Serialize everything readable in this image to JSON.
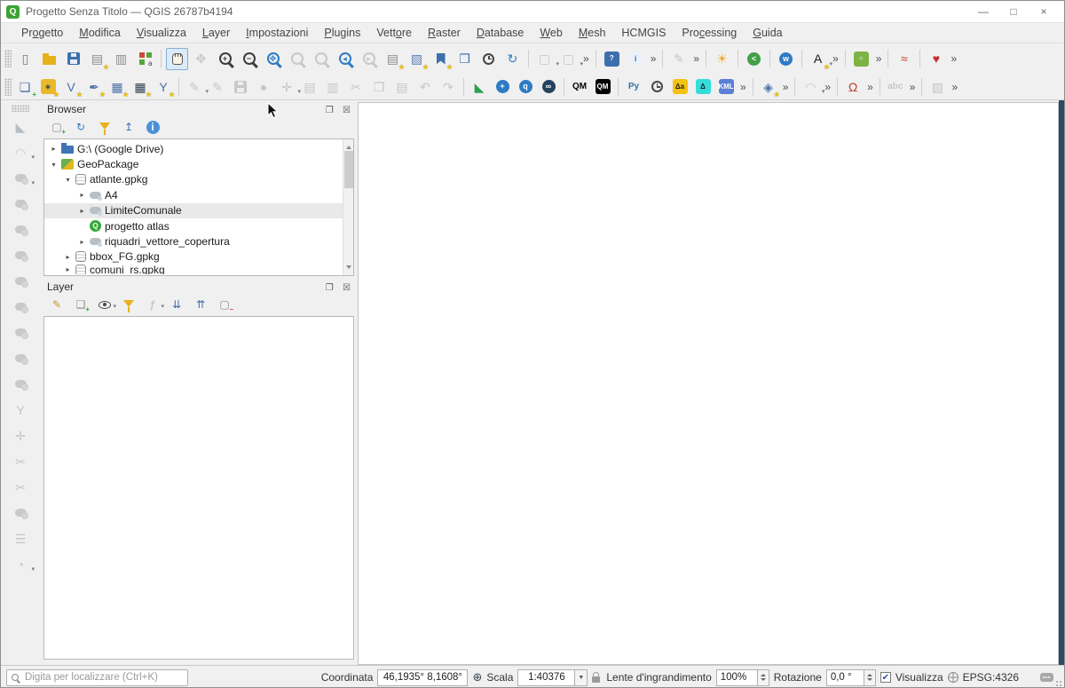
{
  "window": {
    "title": "Progetto Senza Titolo — QGIS 26787b4194",
    "app_icon": "Q",
    "controls": {
      "minimize": "—",
      "maximize": "□",
      "close": "×"
    }
  },
  "badges": {
    "star": "★",
    "plus": "+",
    "minus": "−"
  },
  "menubar": {
    "items": [
      {
        "label": "Progetto",
        "u": 2
      },
      {
        "label": "Modifica",
        "u": 0
      },
      {
        "label": "Visualizza",
        "u": 0
      },
      {
        "label": "Layer",
        "u": 0
      },
      {
        "label": "Impostazioni",
        "u": 0
      },
      {
        "label": "Plugins",
        "u": 0
      },
      {
        "label": "Vettore",
        "u": 4
      },
      {
        "label": "Raster",
        "u": 0
      },
      {
        "label": "Database",
        "u": 0
      },
      {
        "label": "Web",
        "u": 0
      },
      {
        "label": "Mesh",
        "u": 0
      },
      {
        "label": "HCMGIS",
        "u": -1
      },
      {
        "label": "Processing",
        "u": 3
      },
      {
        "label": "Guida",
        "u": 0
      }
    ]
  },
  "toolbars": {
    "row1": [
      {
        "t": "grip"
      },
      {
        "n": "new-project",
        "g": "▯",
        "fg": "#777777"
      },
      {
        "n": "open-project",
        "cls": "ic-folder"
      },
      {
        "n": "save-project",
        "cls": "ic-floppy"
      },
      {
        "n": "new-print-layout",
        "g": "▤",
        "fg": "#8a8a8a",
        "b": "star"
      },
      {
        "n": "layout-manager",
        "g": "▥",
        "fg": "#8a8a8a"
      },
      {
        "n": "style-manager",
        "cls": "ic-style"
      },
      {
        "t": "sep"
      },
      {
        "n": "pan-map",
        "cls": "ic-hand",
        "a": 1
      },
      {
        "n": "pan-to-selection",
        "g": "✥",
        "fg": "#c6c6c6",
        "e": 0
      },
      {
        "n": "zoom-in",
        "cls": "ic-mag",
        "g": "+"
      },
      {
        "n": "zoom-out",
        "cls": "ic-mag",
        "g": "−"
      },
      {
        "n": "zoom-full-extent",
        "cls": "ic-mag",
        "g": "✥",
        "fg": "#2e7bc4"
      },
      {
        "n": "zoom-to-selection",
        "cls": "ic-mag",
        "fg": "#c8c8c8",
        "e": 0
      },
      {
        "n": "zoom-to-layer",
        "cls": "ic-mag",
        "fg": "#c8c8c8",
        "e": 0
      },
      {
        "n": "zoom-last",
        "cls": "ic-mag",
        "g": "◂",
        "fg": "#2e7bc4"
      },
      {
        "n": "zoom-next",
        "cls": "ic-mag",
        "g": "▸",
        "fg": "#c8c8c8",
        "e": 0
      },
      {
        "n": "new-map-view",
        "g": "▤",
        "fg": "#8a8a8a",
        "b": "star"
      },
      {
        "n": "new-3d-map-view",
        "g": "▧",
        "fg": "#5a7fb5",
        "b": "star"
      },
      {
        "n": "new-spatial-bookmark",
        "cls": "ic-bookmark",
        "b": "star"
      },
      {
        "n": "show-spatial-bookmarks",
        "g": "❐",
        "fg": "#3d6fae"
      },
      {
        "n": "temporal-controller",
        "cls": "ic-clock"
      },
      {
        "n": "refresh-map",
        "g": "↻",
        "fg": "#2e7bc4"
      },
      {
        "t": "sep"
      },
      {
        "n": "select-features",
        "g": "▢",
        "fg": "#c6c6c6",
        "e": 0,
        "d": 1
      },
      {
        "n": "deselect-features",
        "g": "▢",
        "fg": "#c6c6c6",
        "e": 0,
        "d": 1
      },
      {
        "t": "more",
        "n": "selection-overflow"
      },
      {
        "t": "sep"
      },
      {
        "n": "help-contents",
        "cls": "sq",
        "g": "?",
        "bg": "#3d6fae",
        "fg": "#ffffff"
      },
      {
        "n": "identify-features",
        "cls": "ic-circle",
        "g": "i",
        "bg": "#eaf1fa",
        "fg": "#2e7bc4"
      },
      {
        "t": "more",
        "n": "attributes-overflow"
      },
      {
        "t": "sep"
      },
      {
        "n": "pin-labels",
        "g": "✎",
        "fg": "#c6c6c6",
        "e": 0
      },
      {
        "t": "more",
        "n": "labels-overflow"
      },
      {
        "t": "sep"
      },
      {
        "n": "sun-calc-plugin",
        "g": "☀",
        "fg": "#f5a623"
      },
      {
        "t": "sep"
      },
      {
        "n": "share-plugin",
        "cls": "ic-circle",
        "g": "<",
        "bg": "#43a047",
        "fg": "#ffffff"
      },
      {
        "t": "sep"
      },
      {
        "n": "web-service-plugin",
        "cls": "ic-circle",
        "g": "w",
        "bg": "#2e7bc4",
        "fg": "#ffffff"
      },
      {
        "t": "sep"
      },
      {
        "n": "layer-labeling-options",
        "g": "A",
        "fg": "#1a1a1a",
        "b": "star",
        "d": 1
      },
      {
        "t": "more",
        "n": "labeling-overflow"
      },
      {
        "t": "sep"
      },
      {
        "n": "quickosm",
        "cls": "sq",
        "g": "○",
        "bg": "#7cb342",
        "fg": "#ffffff"
      },
      {
        "t": "more",
        "n": "quickosm-overflow"
      },
      {
        "t": "sep"
      },
      {
        "n": "data-plotly",
        "g": "≈",
        "fg": "#c0392b"
      },
      {
        "t": "sep"
      },
      {
        "n": "document-generator-plugin",
        "g": "♥",
        "fg": "#cc2f2f"
      },
      {
        "t": "more",
        "n": "plugins-overflow"
      }
    ],
    "row2": [
      {
        "t": "grip"
      },
      {
        "n": "data-source-manager",
        "g": "❏",
        "fg": "#4a6fa5",
        "b": "plus"
      },
      {
        "n": "new-geopackage-layer",
        "cls": "sq",
        "g": "◈",
        "bg": "#e8b92a",
        "fg": "#2c3e50",
        "b": "star"
      },
      {
        "n": "new-shapefile-layer",
        "g": "V",
        "fg": "#4a6fa5",
        "b": "star"
      },
      {
        "n": "new-spatialite-layer",
        "g": "✒",
        "fg": "#4a6fa5",
        "b": "star"
      },
      {
        "n": "new-temporary-scratch-layer",
        "g": "▦",
        "fg": "#4a6fa5",
        "b": "star"
      },
      {
        "n": "new-virtual-layer",
        "g": "▦",
        "fg": "#2c3e50",
        "b": "star"
      },
      {
        "n": "new-mesh-layer",
        "g": "Y",
        "fg": "#4a6fa5",
        "b": "star"
      },
      {
        "t": "sep"
      },
      {
        "n": "current-edits",
        "g": "✎",
        "fg": "#c6c6c6",
        "e": 0,
        "d": 1
      },
      {
        "n": "toggle-editing",
        "g": "✎",
        "fg": "#c6c6c6",
        "e": 0
      },
      {
        "n": "save-layer-edits",
        "cls": "ic-floppy dis",
        "e": 0
      },
      {
        "n": "add-feature",
        "g": "●",
        "fg": "#c6c6c6",
        "e": 0
      },
      {
        "n": "move-feature",
        "g": "✛",
        "fg": "#c6c6c6",
        "e": 0,
        "d": 1
      },
      {
        "n": "multiedit-attributes",
        "g": "▤",
        "fg": "#c6c6c6",
        "e": 0
      },
      {
        "n": "delete-selected",
        "g": "▥",
        "fg": "#c6c6c6",
        "e": 0
      },
      {
        "n": "cut-features",
        "g": "✂",
        "fg": "#c6c6c6",
        "e": 0
      },
      {
        "n": "copy-features",
        "g": "❐",
        "fg": "#c6c6c6",
        "e": 0
      },
      {
        "n": "paste-features",
        "g": "▤",
        "fg": "#c6c6c6",
        "e": 0
      },
      {
        "n": "undo",
        "g": "↶",
        "fg": "#c6c6c6",
        "e": 0
      },
      {
        "n": "redo",
        "g": "↷",
        "fg": "#c6c6c6",
        "e": 0
      },
      {
        "t": "sep"
      },
      {
        "n": "measure-tool",
        "g": "◣",
        "fg": "#2e9e4f"
      },
      {
        "n": "globe-add-layer",
        "cls": "ic-circle",
        "g": "+",
        "bg": "#2e7bc4",
        "fg": "#ffffff"
      },
      {
        "n": "globe-query-layer",
        "cls": "ic-circle",
        "g": "q",
        "bg": "#2e7bc4",
        "fg": "#ffffff"
      },
      {
        "n": "globe-search",
        "cls": "ic-circle",
        "g": "∞",
        "bg": "#24435f",
        "fg": "#ffffff"
      },
      {
        "t": "sep"
      },
      {
        "n": "qm-plugin",
        "cls": "txt",
        "g": "QM",
        "fg": "#000000"
      },
      {
        "n": "qm-console-plugin",
        "cls": "sq",
        "g": "QM",
        "bg": "#000000",
        "fg": "#ffffff"
      },
      {
        "t": "sep"
      },
      {
        "n": "python-console",
        "cls": "txt",
        "g": "Py",
        "fg": "#3771a2"
      },
      {
        "n": "timer-plugin",
        "cls": "ic-clock"
      },
      {
        "n": "delta-attributes-plugin",
        "cls": "sq",
        "g": "Δa",
        "bg": "#f5c211",
        "fg": "#222222"
      },
      {
        "n": "coordinate-converter-plugin",
        "cls": "sq",
        "g": "Δ",
        "bg": "#35dcdc",
        "fg": "#222222"
      },
      {
        "n": "kml-tools-plugin",
        "cls": "sq",
        "g": "KML",
        "bg": "#5b7fd4",
        "fg": "#ffffff"
      },
      {
        "t": "more",
        "n": "plugins2-overflow"
      },
      {
        "t": "sep"
      },
      {
        "n": "vertex-tool",
        "g": "◈",
        "fg": "#4a6fa5",
        "b": "star"
      },
      {
        "t": "more",
        "n": "digitizing-overflow"
      },
      {
        "t": "sep"
      },
      {
        "n": "circular-string-digitizing",
        "g": "◠",
        "fg": "#c6c6c6",
        "e": 0,
        "d": 1
      },
      {
        "t": "more",
        "n": "shape-digitizing-overflow"
      },
      {
        "t": "sep"
      },
      {
        "n": "snapping-toggle",
        "g": "Ω",
        "fg": "#c0392b"
      },
      {
        "t": "more",
        "n": "snapping-overflow"
      },
      {
        "t": "sep"
      },
      {
        "n": "abc-annotation",
        "cls": "txt",
        "g": "abc",
        "fg": "#c6c6c6",
        "e": 0
      },
      {
        "t": "more",
        "n": "annotation-overflow"
      },
      {
        "t": "sep"
      },
      {
        "n": "mesh-digitizing",
        "g": "▨",
        "fg": "#c6c6c6",
        "e": 0
      },
      {
        "t": "more",
        "n": "mesh-overflow"
      }
    ],
    "left": [
      {
        "t": "griph"
      },
      {
        "n": "advanced-digitizing-panel",
        "g": "◣",
        "fg": "#b8bec6",
        "e": 0
      },
      {
        "n": "circular-curve-tool",
        "g": "◠",
        "fg": "#c6c6c6",
        "e": 0,
        "d": 1
      },
      {
        "n": "move-feature-tool",
        "cls": "ic-blob",
        "e": 0,
        "d": 1
      },
      {
        "n": "rotate-feature-tool",
        "cls": "ic-blob",
        "e": 0
      },
      {
        "n": "simplify-feature-tool",
        "cls": "ic-blob",
        "e": 0
      },
      {
        "n": "add-ring-tool",
        "cls": "ic-blob",
        "e": 0
      },
      {
        "n": "add-part-tool",
        "cls": "ic-blob",
        "e": 0
      },
      {
        "n": "fill-ring-tool",
        "cls": "ic-blob",
        "e": 0
      },
      {
        "n": "delete-ring-tool",
        "cls": "ic-blob",
        "e": 0
      },
      {
        "n": "delete-part-tool",
        "cls": "ic-blob",
        "e": 0
      },
      {
        "n": "reshape-features-tool",
        "cls": "ic-blob",
        "e": 0
      },
      {
        "n": "offset-curve-tool",
        "g": "Y",
        "fg": "#c6c6c6",
        "e": 0
      },
      {
        "n": "split-features-tool",
        "g": "✛",
        "fg": "#c6c6c6",
        "e": 0
      },
      {
        "n": "split-parts-tool",
        "g": "✂",
        "fg": "#c6c6c6",
        "e": 0
      },
      {
        "n": "merge-features-tool",
        "g": "✂",
        "fg": "#c6c6c6",
        "e": 0
      },
      {
        "n": "rotate-point-symbols-tool",
        "cls": "ic-blob",
        "e": 0
      },
      {
        "n": "trim-extend-tool",
        "g": "☰",
        "fg": "#c6c6c6",
        "e": 0
      },
      {
        "n": "rotate-label-tool",
        "g": "◔",
        "fg": "#c6c6c6",
        "e": 0,
        "d": 1
      }
    ]
  },
  "browser_panel": {
    "title": "Browser",
    "float_button": "❐",
    "close_button": "☒",
    "tools": [
      {
        "n": "add-selected-layers",
        "g": "▢",
        "fg": "#8a8a8a",
        "b": "plus"
      },
      {
        "n": "refresh-browser",
        "g": "↻",
        "fg": "#2e7bc4"
      },
      {
        "n": "filter-browser",
        "cls": "ic-funnel"
      },
      {
        "n": "collapse-all-browser",
        "g": "↥",
        "fg": "#3d6fae"
      },
      {
        "n": "enable-properties-widget",
        "cls": "ic-circle",
        "g": "i",
        "bg": "#4a90d9",
        "fg": "#ffffff"
      }
    ],
    "tree": [
      {
        "lvl": 0,
        "exp": "▸",
        "ic": "folder-blue",
        "label": "G:\\ (Google Drive)"
      },
      {
        "lvl": 0,
        "exp": "▾",
        "ic": "gpkg-box",
        "label": "GeoPackage"
      },
      {
        "lvl": 1,
        "exp": "▾",
        "ic": "db",
        "label": "atlante.gpkg"
      },
      {
        "lvl": 2,
        "exp": "▸",
        "ic": "vlayer",
        "label": "A4"
      },
      {
        "lvl": 2,
        "exp": "▸",
        "ic": "vlayer",
        "label": "LimiteComunale",
        "sel": true
      },
      {
        "lvl": 2,
        "exp": "",
        "ic": "qgis",
        "icg": "Q",
        "label": "progetto atlas"
      },
      {
        "lvl": 2,
        "exp": "▸",
        "ic": "vlayer",
        "label": "riquadri_vettore_copertura"
      },
      {
        "lvl": 1,
        "exp": "▸",
        "ic": "db",
        "label": "bbox_FG.gpkg"
      },
      {
        "lvl": 1,
        "exp": "▸",
        "ic": "db",
        "label": "comuni_rs.gpkg",
        "cut": true
      }
    ]
  },
  "layer_panel": {
    "title": "Layer",
    "float_button": "❐",
    "close_button": "☒",
    "tools": [
      {
        "n": "open-layer-styling",
        "g": "✎",
        "fg": "#c79a2a"
      },
      {
        "n": "add-group",
        "g": "❏",
        "fg": "#8a8a8a",
        "b": "plus"
      },
      {
        "n": "manage-map-themes",
        "cls": "ic-eye",
        "d": 1
      },
      {
        "n": "filter-legend",
        "cls": "ic-funnel"
      },
      {
        "n": "filter-by-expression",
        "cls": "txt",
        "g": "ƒ",
        "fg": "#c6c6c6",
        "e": 0,
        "d": 1
      },
      {
        "n": "expand-all-layers",
        "g": "⇊",
        "fg": "#3d6fae"
      },
      {
        "n": "collapse-all-layers",
        "g": "⇈",
        "fg": "#3d6fae"
      },
      {
        "n": "remove-layer-group",
        "g": "▢",
        "fg": "#8a8a8a",
        "b": "minus"
      }
    ]
  },
  "statusbar": {
    "locator_placeholder": "Digita per localizzare (Ctrl+K)",
    "coordinate_label": "Coordinata",
    "coordinate_value": "46,1935° 8,1608°",
    "extent_toggle_icon": "⊕",
    "scale_label": "Scala",
    "scale_value": "1:40376",
    "magnifier_label": "Lente d'ingrandimento",
    "magnifier_value": "100%",
    "rotation_label": "Rotazione",
    "rotation_value": "0,0 °",
    "render_label": "Visualizza",
    "render_check": "✔",
    "crs_label": "EPSG:4326"
  }
}
